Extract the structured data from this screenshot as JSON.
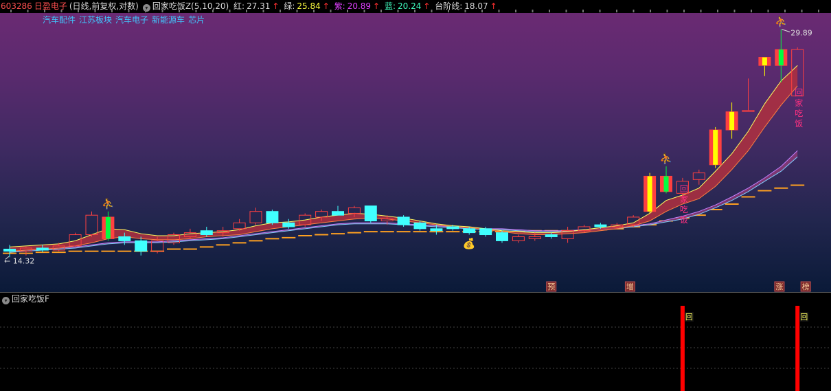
{
  "header": {
    "code": "603286",
    "name": "日盈电子",
    "mode": "(日线,前复权,对数)",
    "indicator": "回家吃饭Z(5,10,20)",
    "red_label": "红:",
    "red_value": "27.31",
    "green_label": "绿:",
    "green_value": "25.84",
    "purple_label": "紫:",
    "purple_value": "20.89",
    "blue_label": "蓝:",
    "blue_value": "20.24",
    "step_label": "台阶线:",
    "step_value": "18.07",
    "arrow": "↑"
  },
  "sectors": [
    "汽车配件",
    "江苏板块",
    "汽车电子",
    "新能源车",
    "芯片"
  ],
  "sub_panel": {
    "title": "回家吃饭F",
    "signal_label": "回"
  },
  "colors": {
    "up": "#ff4040",
    "down": "#40ffff",
    "green_candle": "#00ff40",
    "yellow_candle": "#ffff00",
    "band_fill": "#b03040",
    "slow_band": "#8a3a78",
    "step_line": "#ffa020",
    "signal_bar": "#ff0000"
  },
  "chart_data": {
    "type": "candlestick",
    "scale": "log",
    "ylim": [
      13.2,
      31.5
    ],
    "high_label": "29.89",
    "low_label": "14.32",
    "tags": [
      "预",
      "增",
      "涨",
      "榜"
    ],
    "signal_text": "回家吃饭",
    "candles": [
      {
        "o": 14.7,
        "h": 14.9,
        "l": 14.32,
        "c": 14.6,
        "s": "down"
      },
      {
        "o": 14.6,
        "h": 14.8,
        "l": 14.4,
        "c": 14.75,
        "s": "up"
      },
      {
        "o": 14.75,
        "h": 14.9,
        "l": 14.55,
        "c": 14.65,
        "s": "down"
      },
      {
        "o": 14.65,
        "h": 15.0,
        "l": 14.6,
        "c": 14.85,
        "s": "up"
      },
      {
        "o": 14.85,
        "h": 15.5,
        "l": 14.8,
        "c": 15.4,
        "s": "up"
      },
      {
        "o": 15.4,
        "h": 16.6,
        "l": 15.3,
        "c": 16.4,
        "s": "up"
      },
      {
        "o": 16.3,
        "h": 16.6,
        "l": 15.1,
        "c": 15.2,
        "s": "green"
      },
      {
        "o": 15.3,
        "h": 15.5,
        "l": 14.9,
        "c": 15.1,
        "s": "down"
      },
      {
        "o": 15.1,
        "h": 15.3,
        "l": 14.4,
        "c": 14.6,
        "s": "down"
      },
      {
        "o": 14.6,
        "h": 15.3,
        "l": 14.5,
        "c": 15.1,
        "s": "up"
      },
      {
        "o": 15.0,
        "h": 15.5,
        "l": 14.9,
        "c": 15.4,
        "s": "up"
      },
      {
        "o": 15.3,
        "h": 15.7,
        "l": 15.2,
        "c": 15.5,
        "s": "up"
      },
      {
        "o": 15.6,
        "h": 15.8,
        "l": 15.3,
        "c": 15.4,
        "s": "down"
      },
      {
        "o": 15.5,
        "h": 15.8,
        "l": 15.3,
        "c": 15.6,
        "s": "up"
      },
      {
        "o": 15.7,
        "h": 16.2,
        "l": 15.6,
        "c": 16.0,
        "s": "up"
      },
      {
        "o": 16.0,
        "h": 16.8,
        "l": 15.9,
        "c": 16.6,
        "s": "up"
      },
      {
        "o": 16.6,
        "h": 16.7,
        "l": 15.9,
        "c": 16.0,
        "s": "down"
      },
      {
        "o": 16.0,
        "h": 16.2,
        "l": 15.7,
        "c": 15.8,
        "s": "down"
      },
      {
        "o": 15.9,
        "h": 16.5,
        "l": 15.8,
        "c": 16.4,
        "s": "up"
      },
      {
        "o": 16.3,
        "h": 16.7,
        "l": 16.1,
        "c": 16.6,
        "s": "up"
      },
      {
        "o": 16.6,
        "h": 16.9,
        "l": 16.4,
        "c": 16.4,
        "s": "down"
      },
      {
        "o": 16.5,
        "h": 16.9,
        "l": 16.3,
        "c": 16.8,
        "s": "up"
      },
      {
        "o": 16.9,
        "h": 16.9,
        "l": 16.0,
        "c": 16.1,
        "s": "down"
      },
      {
        "o": 16.1,
        "h": 16.4,
        "l": 15.9,
        "c": 16.2,
        "s": "up"
      },
      {
        "o": 16.3,
        "h": 16.4,
        "l": 15.8,
        "c": 15.9,
        "s": "down"
      },
      {
        "o": 16.0,
        "h": 16.1,
        "l": 15.6,
        "c": 15.7,
        "s": "down"
      },
      {
        "o": 15.7,
        "h": 15.9,
        "l": 15.4,
        "c": 15.6,
        "s": "down"
      },
      {
        "o": 15.7,
        "h": 15.9,
        "l": 15.6,
        "c": 15.8,
        "s": "down"
      },
      {
        "o": 15.7,
        "h": 15.8,
        "l": 15.4,
        "c": 15.5,
        "s": "down"
      },
      {
        "o": 15.7,
        "h": 15.8,
        "l": 15.3,
        "c": 15.4,
        "s": "down"
      },
      {
        "o": 15.5,
        "h": 15.6,
        "l": 15.0,
        "c": 15.1,
        "s": "down"
      },
      {
        "o": 15.1,
        "h": 15.4,
        "l": 15.0,
        "c": 15.3,
        "s": "up"
      },
      {
        "o": 15.3,
        "h": 15.5,
        "l": 15.1,
        "c": 15.2,
        "s": "up"
      },
      {
        "o": 15.4,
        "h": 15.5,
        "l": 15.2,
        "c": 15.3,
        "s": "down"
      },
      {
        "o": 15.2,
        "h": 15.8,
        "l": 15.0,
        "c": 15.6,
        "s": "up"
      },
      {
        "o": 15.6,
        "h": 15.9,
        "l": 15.5,
        "c": 15.8,
        "s": "up"
      },
      {
        "o": 15.8,
        "h": 16.0,
        "l": 15.7,
        "c": 15.9,
        "s": "down"
      },
      {
        "o": 15.9,
        "h": 16.0,
        "l": 15.7,
        "c": 15.8,
        "s": "up"
      },
      {
        "o": 15.9,
        "h": 16.4,
        "l": 15.8,
        "c": 16.3,
        "s": "up"
      },
      {
        "o": 16.6,
        "h": 18.8,
        "l": 16.5,
        "c": 18.6,
        "s": "yellow"
      },
      {
        "o": 18.6,
        "h": 19.2,
        "l": 17.6,
        "c": 17.7,
        "s": "green"
      },
      {
        "o": 17.6,
        "h": 18.5,
        "l": 17.4,
        "c": 18.3,
        "s": "up"
      },
      {
        "o": 18.4,
        "h": 19.0,
        "l": 18.1,
        "c": 18.8,
        "s": "up"
      },
      {
        "o": 19.3,
        "h": 21.8,
        "l": 19.1,
        "c": 21.6,
        "s": "yellow"
      },
      {
        "o": 21.6,
        "h": 23.6,
        "l": 21.0,
        "c": 22.9,
        "s": "yellow"
      },
      {
        "o": 23.0,
        "h": 25.5,
        "l": 23.0,
        "c": 23.0,
        "s": "up"
      },
      {
        "o": 26.6,
        "h": 27.0,
        "l": 25.7,
        "c": 27.3,
        "s": "yellow"
      },
      {
        "o": 28.0,
        "h": 29.89,
        "l": 25.2,
        "c": 26.6,
        "s": "green"
      },
      {
        "o": 28.0,
        "h": 28.2,
        "l": 24.1,
        "c": 24.1,
        "s": "up"
      }
    ],
    "fast_upper": [
      14.8,
      14.85,
      14.9,
      14.95,
      15.1,
      15.4,
      15.7,
      15.65,
      15.45,
      15.35,
      15.35,
      15.45,
      15.5,
      15.55,
      15.65,
      15.85,
      16.0,
      16.05,
      16.15,
      16.3,
      16.4,
      16.5,
      16.45,
      16.35,
      16.25,
      16.1,
      15.95,
      15.85,
      15.8,
      15.7,
      15.6,
      15.55,
      15.5,
      15.5,
      15.55,
      15.65,
      15.75,
      15.85,
      16.0,
      16.5,
      17.2,
      17.5,
      17.9,
      18.9,
      20.0,
      21.5,
      23.5,
      25.3,
      26.6
    ],
    "fast_lower": [
      14.6,
      14.65,
      14.7,
      14.75,
      14.85,
      15.0,
      15.2,
      15.3,
      15.2,
      15.15,
      15.15,
      15.2,
      15.3,
      15.35,
      15.4,
      15.55,
      15.7,
      15.8,
      15.9,
      16.0,
      16.1,
      16.2,
      16.25,
      16.2,
      16.1,
      16.0,
      15.9,
      15.8,
      15.75,
      15.65,
      15.55,
      15.45,
      15.4,
      15.4,
      15.45,
      15.5,
      15.6,
      15.7,
      15.85,
      16.1,
      16.6,
      17.0,
      17.3,
      18.0,
      19.0,
      20.2,
      21.8,
      23.4,
      24.9
    ],
    "slow_upper": [
      14.6,
      14.65,
      14.7,
      14.75,
      14.8,
      14.9,
      15.0,
      15.05,
      15.05,
      15.05,
      15.1,
      15.15,
      15.2,
      15.25,
      15.35,
      15.45,
      15.55,
      15.65,
      15.75,
      15.85,
      15.95,
      16.0,
      16.0,
      16.0,
      15.95,
      15.9,
      15.85,
      15.8,
      15.75,
      15.7,
      15.7,
      15.65,
      15.6,
      15.6,
      15.6,
      15.65,
      15.7,
      15.75,
      15.85,
      15.95,
      16.15,
      16.35,
      16.6,
      16.95,
      17.4,
      17.9,
      18.5,
      19.2,
      20.2
    ],
    "slow_lower": [
      14.55,
      14.6,
      14.65,
      14.7,
      14.75,
      14.85,
      14.95,
      15.0,
      15.0,
      15.0,
      15.05,
      15.1,
      15.15,
      15.2,
      15.3,
      15.4,
      15.5,
      15.6,
      15.7,
      15.8,
      15.9,
      15.95,
      15.95,
      15.95,
      15.9,
      15.85,
      15.8,
      15.75,
      15.7,
      15.65,
      15.65,
      15.6,
      15.55,
      15.55,
      15.55,
      15.6,
      15.65,
      15.7,
      15.8,
      15.9,
      16.05,
      16.2,
      16.45,
      16.8,
      17.2,
      17.7,
      18.3,
      18.9,
      19.8
    ],
    "step_line": [
      14.5,
      14.5,
      14.55,
      14.55,
      14.6,
      14.6,
      14.6,
      14.6,
      14.6,
      14.6,
      14.7,
      14.7,
      14.8,
      14.9,
      15.0,
      15.1,
      15.2,
      15.25,
      15.35,
      15.4,
      15.45,
      15.5,
      15.55,
      15.55,
      15.55,
      15.55,
      15.55,
      15.55,
      15.55,
      15.55,
      15.55,
      15.55,
      15.6,
      15.6,
      15.6,
      15.6,
      15.65,
      15.7,
      15.8,
      15.9,
      16.1,
      16.25,
      16.4,
      16.7,
      17.0,
      17.4,
      17.75,
      17.9,
      18.07
    ],
    "stars": [
      6,
      40,
      47
    ],
    "money": 28,
    "signals": [
      41,
      48
    ]
  }
}
